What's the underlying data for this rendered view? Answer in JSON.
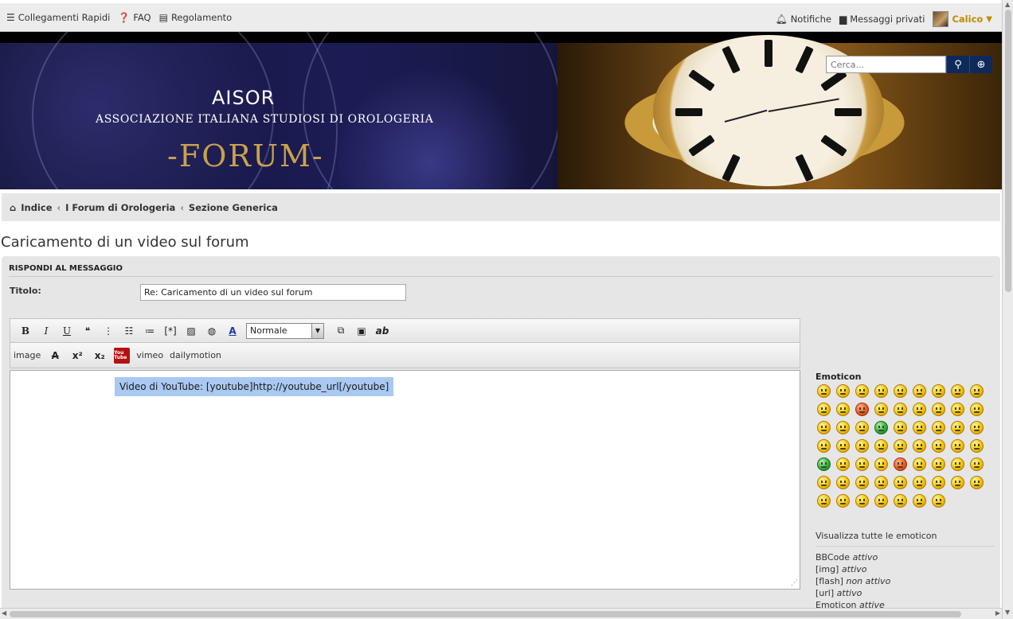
{
  "topbar": {
    "quick_links": "Collegamenti Rapidi",
    "faq": "FAQ",
    "rules": "Regolamento",
    "notifications": "Notifiche",
    "messages": "Messaggi privati",
    "username": "Calico",
    "username_color": "#c08a00"
  },
  "header": {
    "brand": "AISOR",
    "subtitle": "ASSOCIAZIONE ITALIANA STUDIOSI DI OROLOGERIA",
    "forum": "-FORUM-",
    "search_placeholder": "Cerca...",
    "search_button_color": "#0e2a5a"
  },
  "breadcrumb": {
    "home": "Indice",
    "level1": "I Forum di Orologeria",
    "level2": "Sezione Generica"
  },
  "page": {
    "title": "Caricamento di un video sul forum"
  },
  "reply": {
    "heading": "RISPONDI AL MESSAGGIO",
    "subject_label": "Titolo:",
    "subject_value": "Re: Caricamento di un video sul forum",
    "font_size_selected": "Normale",
    "extra_buttons": {
      "image": "image",
      "vimeo": "vimeo",
      "dailymotion": "dailymotion"
    },
    "youtube_icon_text": "You Tube",
    "editor_highlight": "Video di YouTube: [youtube]http://youtube_url[/youtube]"
  },
  "sidebar": {
    "emoticon_title": "Emoticon",
    "show_all": "Visualizza tutte le emoticon",
    "status": [
      {
        "label": "BBCode",
        "value": "attivo"
      },
      {
        "label": "[img]",
        "value": "attivo"
      },
      {
        "label": "[flash]",
        "value": "non attivo"
      },
      {
        "label": "[url]",
        "value": "attivo"
      },
      {
        "label": "Emoticon",
        "value": "attive"
      }
    ]
  }
}
